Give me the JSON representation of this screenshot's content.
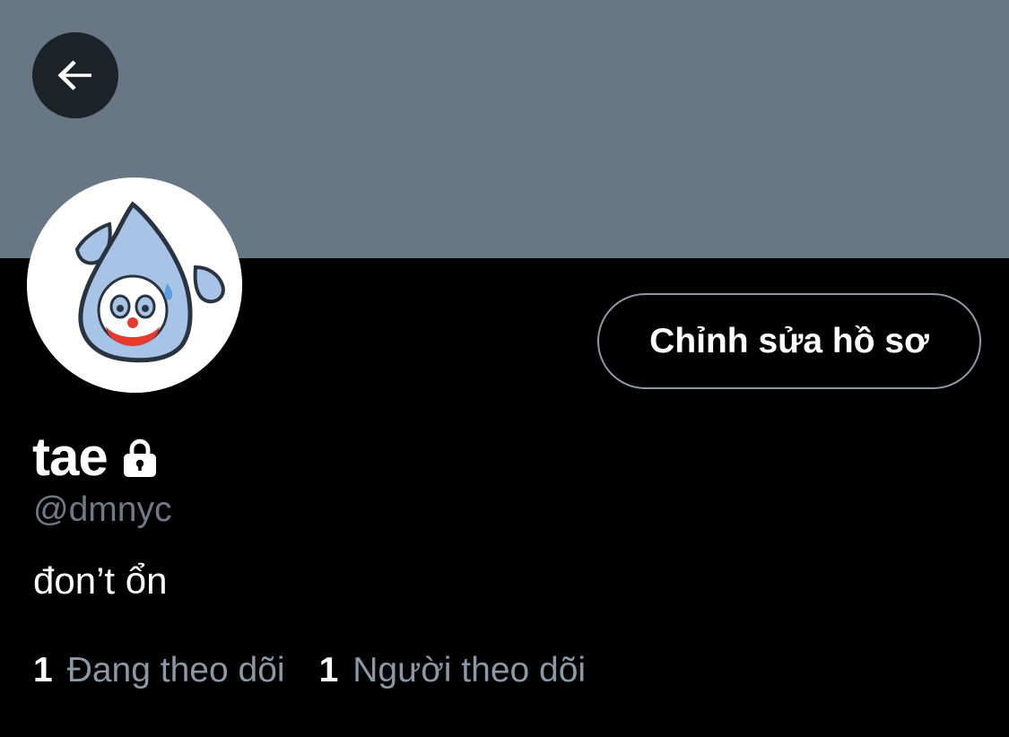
{
  "profile": {
    "display_name": "tae",
    "handle": "@dmnyc",
    "bio": "đon’t ổn",
    "edit_button_label": "Chỉnh sửa hồ sơ",
    "locked": true
  },
  "stats": {
    "following_count": "1",
    "following_label": "Đang theo dõi",
    "followers_count": "1",
    "followers_label": "Người theo dõi"
  },
  "icons": {
    "back": "arrow-left-icon",
    "lock": "lock-icon",
    "avatar": "sweat-drop-clown-avatar"
  },
  "colors": {
    "banner": "#687785",
    "background": "#000000",
    "secondary_text": "#8b98a5",
    "button_border": "#8b98a5"
  }
}
